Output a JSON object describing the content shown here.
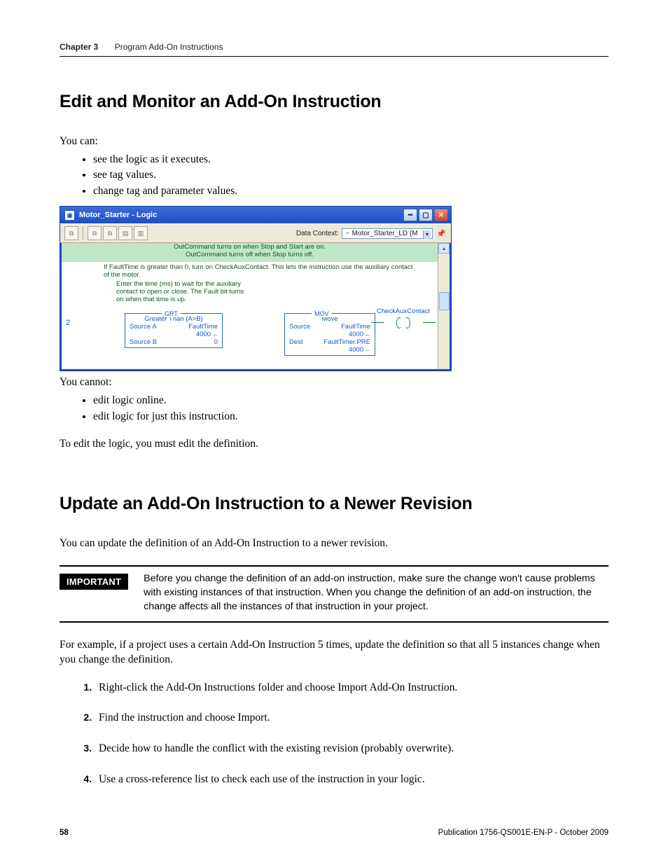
{
  "header": {
    "chapter": "Chapter 3",
    "title": "Program Add-On Instructions"
  },
  "section1": {
    "heading": "Edit and Monitor an Add-On Instruction",
    "intro_can": "You can:",
    "can_bullets": [
      "see the logic as it executes.",
      "see tag values.",
      "change tag and parameter values."
    ],
    "intro_cannot": "You cannot:",
    "cannot_bullets": [
      "edit logic online.",
      "edit logic for just this instruction."
    ],
    "closing": "To edit the logic, you must edit the definition."
  },
  "screenshot": {
    "window_title": "Motor_Starter - Logic",
    "data_context_label": "Data Context:",
    "data_context_value": "Motor_Starter_LD (M",
    "band_line1": "OutCommand turns on when Stop and Start are on.",
    "band_line2": "OutCommand turns off when Stop turns off.",
    "rung_comment": "If FaultTime is greater than 0, turn on CheckAuxContact. This lets the instruction use the auxiliary contact of the motor.",
    "operand_comment": "Enter the time (ms) to wait for the auxiliary contact to open or close. The Fault bit turns on when that time is up.",
    "rung_number": "2",
    "grt": {
      "mnemonic": "GRT",
      "title": "Greater Than (A>B)",
      "srcA_label": "Source A",
      "srcA_val": "FaultTime",
      "srcA_live": "4000",
      "srcB_label": "Source B",
      "srcB_val": "0"
    },
    "mov": {
      "mnemonic": "MOV",
      "title": "Move",
      "src_label": "Source",
      "src_val": "FaultTime",
      "src_live": "4000",
      "dest_label": "Dest",
      "dest_val": "FaultTimer.PRE",
      "dest_live": "4000"
    },
    "coil_label": "CheckAuxContact"
  },
  "section2": {
    "heading": "Update an Add-On Instruction to a Newer Revision",
    "intro": "You can update the definition of an Add-On Instruction to a newer revision.",
    "important_label": "IMPORTANT",
    "important_text": "Before you change the definition of an add-on instruction, make sure the change won't cause problems with existing instances of that instruction. When you change the definition of an add-on instruction, the change affects all the instances of that instruction in your project.",
    "example": "For example, if a project uses a certain Add-On Instruction 5 times, update the definition so that all 5 instances change when you change the definition.",
    "steps": [
      "Right-click the Add-On Instructions folder and choose Import Add-On Instruction.",
      "Find the instruction and choose Import.",
      "Decide how to handle the conflict with the existing revision (probably overwrite).",
      "Use a cross-reference list to check each use of the instruction in your logic."
    ]
  },
  "footer": {
    "page": "58",
    "pub": "Publication 1756-QS001E-EN-P - October 2009"
  }
}
